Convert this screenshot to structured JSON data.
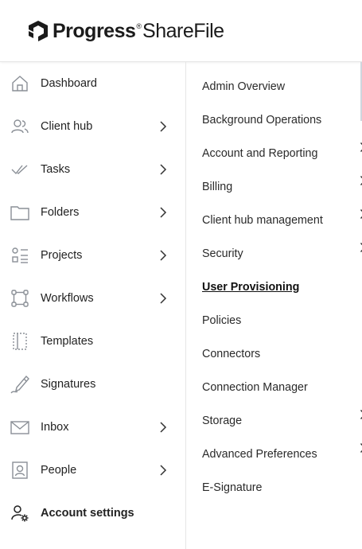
{
  "brand": {
    "name_part1": "Progress",
    "trademark": "®",
    "name_part2": "ShareFile"
  },
  "nav": {
    "items": [
      {
        "label": "Dashboard",
        "icon": "home-icon",
        "has_chevron": false
      },
      {
        "label": "Client hub",
        "icon": "users-icon",
        "has_chevron": true
      },
      {
        "label": "Tasks",
        "icon": "tasks-check-icon",
        "has_chevron": true
      },
      {
        "label": "Folders",
        "icon": "folder-icon",
        "has_chevron": true
      },
      {
        "label": "Projects",
        "icon": "projects-icon",
        "has_chevron": true
      },
      {
        "label": "Workflows",
        "icon": "workflow-icon",
        "has_chevron": true
      },
      {
        "label": "Templates",
        "icon": "template-icon",
        "has_chevron": false
      },
      {
        "label": "Signatures",
        "icon": "signature-pen-icon",
        "has_chevron": false
      },
      {
        "label": "Inbox",
        "icon": "mail-icon",
        "has_chevron": true
      },
      {
        "label": "People",
        "icon": "person-card-icon",
        "has_chevron": true
      },
      {
        "label": "Account settings",
        "icon": "account-settings-icon",
        "has_chevron": false,
        "selected": true
      }
    ]
  },
  "submenu": {
    "items": [
      {
        "label": "Admin Overview",
        "has_chevron": false
      },
      {
        "label": "Background Operations",
        "has_chevron": false
      },
      {
        "label": "Account and Reporting",
        "has_chevron": true
      },
      {
        "label": "Billing",
        "has_chevron": true
      },
      {
        "label": "Client hub management",
        "has_chevron": true
      },
      {
        "label": "Security",
        "has_chevron": true
      },
      {
        "label": "User Provisioning",
        "has_chevron": false,
        "active": true
      },
      {
        "label": "Policies",
        "has_chevron": false
      },
      {
        "label": "Connectors",
        "has_chevron": false
      },
      {
        "label": "Connection Manager",
        "has_chevron": false
      },
      {
        "label": "Storage",
        "has_chevron": true
      },
      {
        "label": "Advanced Preferences",
        "has_chevron": true
      },
      {
        "label": "E-Signature",
        "has_chevron": false
      }
    ]
  },
  "colors": {
    "icon_stroke": "#8a8f96",
    "text": "#222222",
    "divider": "#e6e6e6",
    "active_icon": "#1f1f1f"
  }
}
